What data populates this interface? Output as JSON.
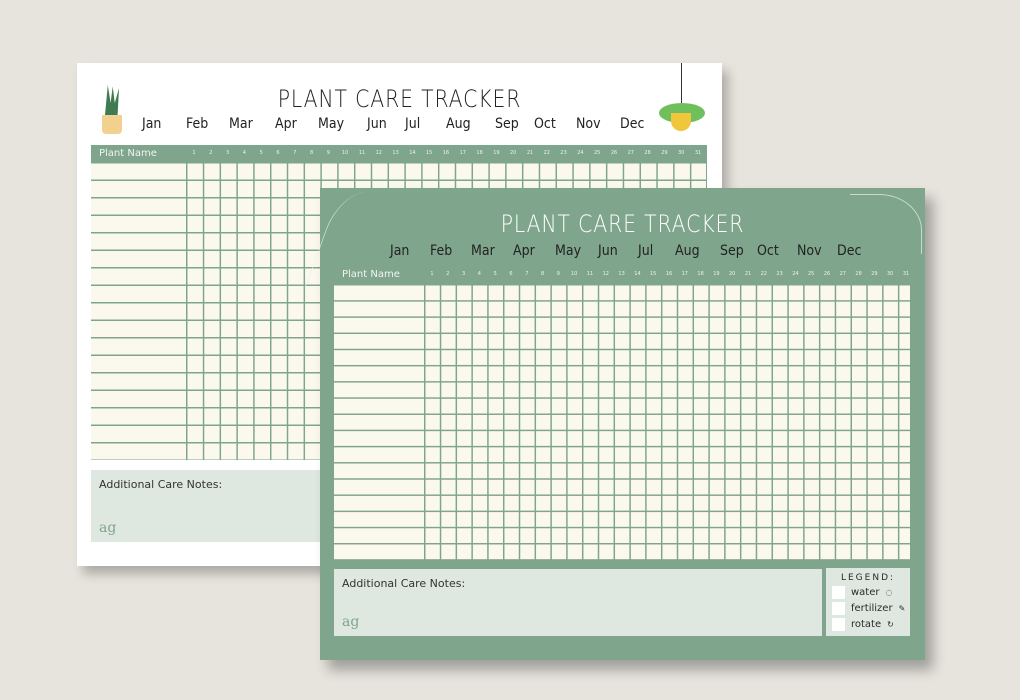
{
  "back_sheet": {
    "title": "PLANT CARE TRACKER",
    "months": [
      "Jan",
      "Feb",
      "Mar",
      "Apr",
      "May",
      "Jun",
      "Jul",
      "Aug",
      "Sep",
      "Oct",
      "Nov",
      "Dec"
    ],
    "header": {
      "plant_name": "Plant Name"
    },
    "days": [
      "1",
      "2",
      "3",
      "4",
      "5",
      "6",
      "7",
      "8",
      "9",
      "10",
      "11",
      "12",
      "13",
      "14",
      "15",
      "16",
      "17",
      "18",
      "19",
      "20",
      "21",
      "22",
      "23",
      "24",
      "25",
      "26",
      "27",
      "28",
      "29",
      "30",
      "31"
    ],
    "notes_label": "Additional Care Notes:",
    "logo": "ag"
  },
  "front_sheet": {
    "title": "PLANT CARE TRACKER",
    "months": [
      "Jan",
      "Feb",
      "Mar",
      "Apr",
      "May",
      "Jun",
      "Jul",
      "Aug",
      "Sep",
      "Oct",
      "Nov",
      "Dec"
    ],
    "header": {
      "plant_name": "Plant Name"
    },
    "days": [
      "1",
      "2",
      "3",
      "4",
      "5",
      "6",
      "7",
      "8",
      "9",
      "10",
      "11",
      "12",
      "13",
      "14",
      "15",
      "16",
      "17",
      "18",
      "19",
      "20",
      "21",
      "22",
      "23",
      "24",
      "25",
      "26",
      "27",
      "28",
      "29",
      "30",
      "31"
    ],
    "notes_label": "Additional Care Notes:",
    "logo": "ag",
    "legend": {
      "title": "LEGEND:",
      "items": [
        {
          "label": "water",
          "icon": "water-drop-icon",
          "glyph": "💧"
        },
        {
          "label": "fertilizer",
          "icon": "fertilizer-icon",
          "glyph": "✎"
        },
        {
          "label": "rotate",
          "icon": "rotate-icon",
          "glyph": "↻"
        }
      ]
    }
  },
  "colors": {
    "green": "#7fa58c",
    "cream": "#fbf9ee",
    "notes_bg": "#dfe7e1",
    "background": "#e7e4dd"
  }
}
